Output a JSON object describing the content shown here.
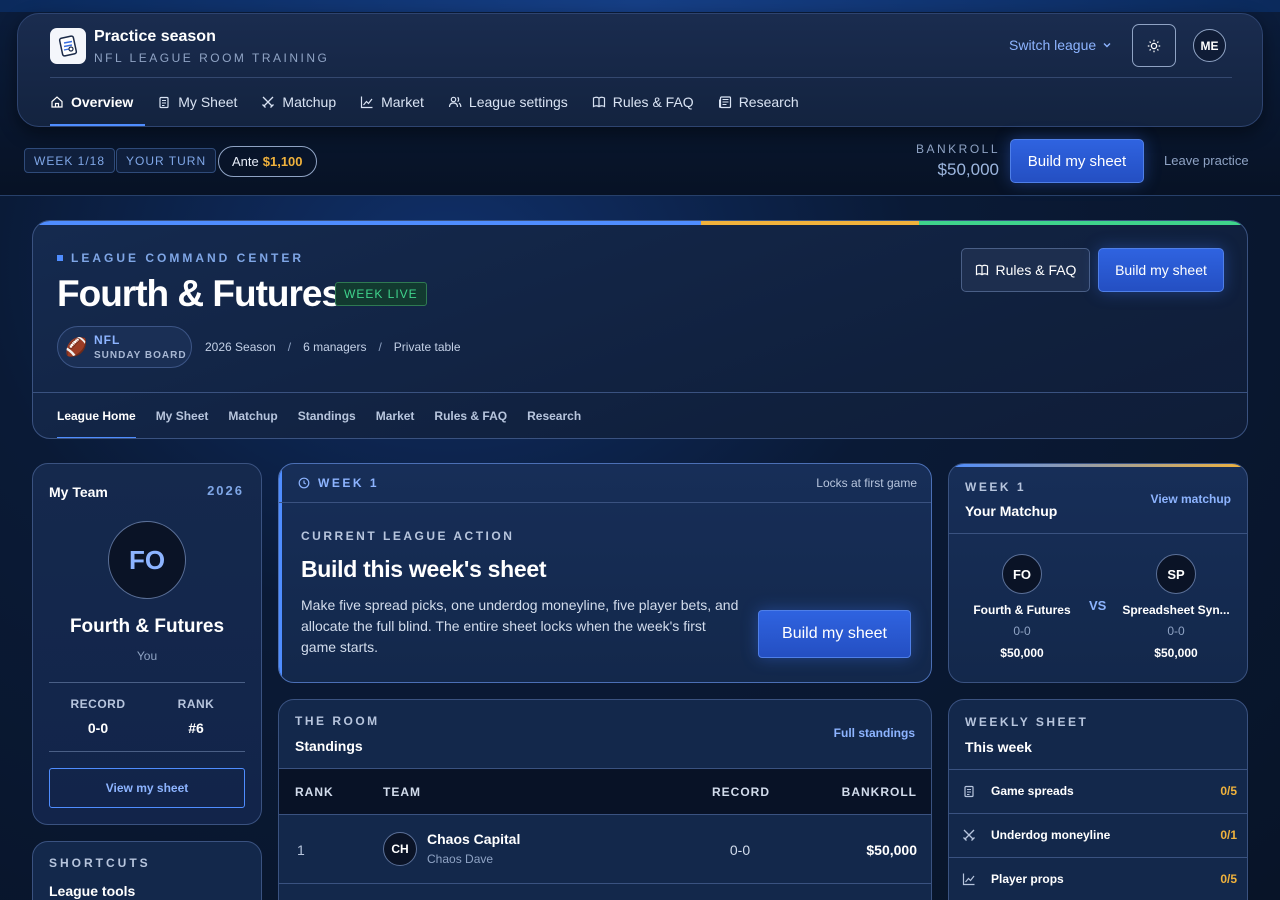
{
  "app": {
    "title": "Practice season",
    "subtitle": "NFL LEAGUE ROOM TRAINING",
    "switch_league": "Switch league",
    "avatar_initials": "ME"
  },
  "nav": [
    {
      "label": "Overview",
      "icon": "home-icon",
      "active": true
    },
    {
      "label": "My Sheet",
      "icon": "clipboard-icon"
    },
    {
      "label": "Matchup",
      "icon": "swords-icon"
    },
    {
      "label": "Market",
      "icon": "chart-icon"
    },
    {
      "label": "League settings",
      "icon": "users-icon"
    },
    {
      "label": "Rules & FAQ",
      "icon": "book-icon"
    },
    {
      "label": "Research",
      "icon": "newspaper-icon"
    }
  ],
  "status": {
    "week": "WEEK 1/18",
    "turn": "YOUR TURN",
    "ante_label": "Ante",
    "ante_amount": "$1,100",
    "bankroll_label": "BANKROLL",
    "bankroll_value": "$50,000",
    "build_button": "Build my sheet",
    "leave": "Leave practice"
  },
  "command_center": {
    "label": "LEAGUE COMMAND CENTER",
    "title": "Fourth & Futures",
    "badge": "WEEK LIVE",
    "league_abbrev": "NFL",
    "league_board": "SUNDAY BOARD",
    "season": "2026 Season",
    "managers": "6 managers",
    "privacy": "Private table",
    "rules_button": "Rules & FAQ",
    "build_button": "Build my sheet",
    "subnav": [
      "League Home",
      "My Sheet",
      "Matchup",
      "Standings",
      "Market",
      "Rules & FAQ",
      "Research"
    ],
    "accent_colors": [
      "#4f8dff",
      "#f0b23c",
      "#3fd48c"
    ]
  },
  "my_team": {
    "title": "My Team",
    "year": "2026",
    "initials": "FO",
    "name": "Fourth & Futures",
    "role": "You",
    "record_label": "RECORD",
    "record": "0-0",
    "rank_label": "RANK",
    "rank": "#6",
    "view_button": "View my sheet"
  },
  "shortcuts": {
    "label": "SHORTCUTS",
    "title": "League tools"
  },
  "week_action": {
    "week_label": "WEEK 1",
    "lock_note": "Locks at first game",
    "eyebrow": "CURRENT LEAGUE ACTION",
    "title": "Build this week's sheet",
    "description": "Make five spread picks, one underdog moneyline, five player bets, and allocate the full blind. The entire sheet locks when the week's first game starts.",
    "button": "Build my sheet"
  },
  "matchup": {
    "week": "WEEK 1",
    "title": "Your Matchup",
    "view_link": "View matchup",
    "vs": "VS",
    "home": {
      "initials": "FO",
      "name": "Fourth & Futures",
      "record": "0-0",
      "bankroll": "$50,000"
    },
    "away": {
      "initials": "SP",
      "name": "Spreadsheet Syn...",
      "record": "0-0",
      "bankroll": "$50,000"
    }
  },
  "standings": {
    "label": "THE ROOM",
    "title": "Standings",
    "full_link": "Full standings",
    "columns": [
      "RANK",
      "TEAM",
      "RECORD",
      "BANKROLL"
    ],
    "rows": [
      {
        "rank": "1",
        "initials": "CH",
        "team": "Chaos Capital",
        "owner": "Chaos Dave",
        "record": "0-0",
        "bankroll": "$50,000"
      }
    ]
  },
  "weekly_sheet": {
    "label": "WEEKLY SHEET",
    "title": "This week",
    "items": [
      {
        "name": "Game spreads",
        "count": "0/5",
        "icon": "clipboard-icon"
      },
      {
        "name": "Underdog moneyline",
        "count": "0/1",
        "icon": "swords-icon"
      },
      {
        "name": "Player props",
        "count": "0/5",
        "icon": "chart-icon"
      }
    ]
  }
}
